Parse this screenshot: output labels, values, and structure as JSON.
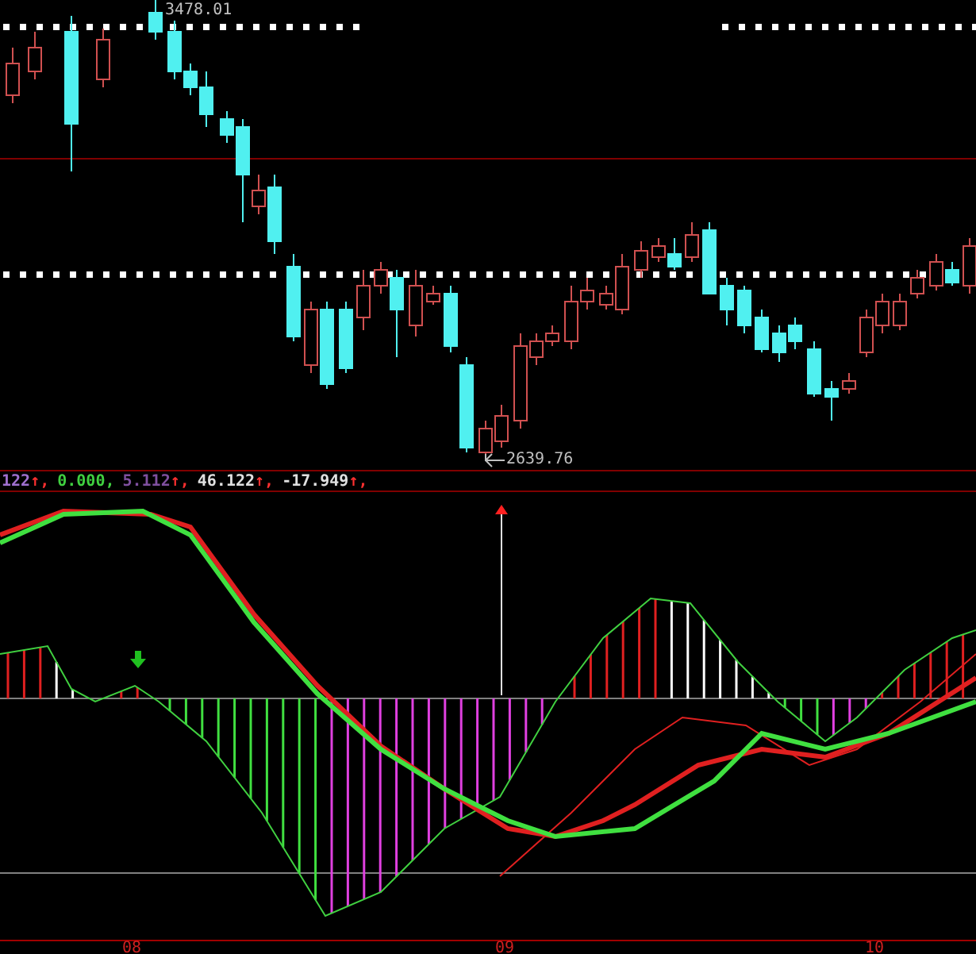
{
  "price_chart": {
    "high_label": "3478.01",
    "low_label": "2639.76"
  },
  "indicator": {
    "legend": [
      {
        "value": "122",
        "arrow": "↑,"
      },
      {
        "value": "0.000,"
      },
      {
        "value": "5.112",
        "arrow": "↑,"
      },
      {
        "value": "46.122",
        "arrow": "↑,"
      },
      {
        "value": "-17.949",
        "arrow": "↑,"
      }
    ]
  },
  "x_axis": {
    "labels": [
      "08",
      "09",
      "10"
    ]
  }
}
